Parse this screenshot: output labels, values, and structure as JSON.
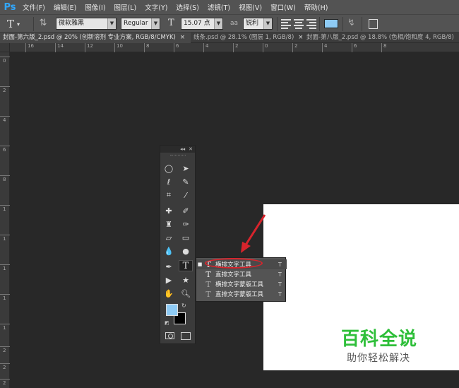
{
  "app": {
    "logo": "Ps"
  },
  "menu": [
    "文件(F)",
    "编辑(E)",
    "图像(I)",
    "图层(L)",
    "文字(Y)",
    "选择(S)",
    "滤镜(T)",
    "视图(V)",
    "窗口(W)",
    "帮助(H)"
  ],
  "options_bar": {
    "tool_glyph": "T",
    "font_family": "微软雅黑",
    "font_style": "Regular",
    "font_size": "15.07 点",
    "aa_label": "aa",
    "anti_alias": "锐利",
    "text_color": "#8ecbf5"
  },
  "tabs": [
    {
      "label": "封面-第六版_2.psd @ 20% (创新溶剂 专业方案, RGB/8/CMYK)",
      "close": "×"
    },
    {
      "label": "线条.psd @ 28.1% (图层 1, RGB/8)",
      "close": "×"
    },
    {
      "label": "封面-第八版_2.psd @ 18.8% (色相/饱和度 4, RGB/8)",
      "close": "×"
    }
  ],
  "ruler": {
    "horizontal": [
      "16",
      "14",
      "12",
      "10",
      "8",
      "6",
      "4",
      "2",
      "0",
      "2",
      "4",
      "6",
      "8"
    ],
    "vertical": [
      "0",
      "2",
      "4",
      "6",
      "8",
      "1",
      "1",
      "1",
      "1",
      "1",
      "2",
      "2",
      "2"
    ]
  },
  "toolbox": {
    "foreground_color": "#8ecbf5",
    "background_color": "#000000"
  },
  "flyout": {
    "items": [
      {
        "label": "横排文字工具",
        "key": "T",
        "active": true
      },
      {
        "label": "直排文字工具",
        "key": "T",
        "active": false
      },
      {
        "label": "横排文字蒙版工具",
        "key": "T",
        "active": false
      },
      {
        "label": "直排文字蒙版工具",
        "key": "T",
        "active": false
      }
    ]
  },
  "watermark": {
    "title": "百科全说",
    "subtitle": "助你轻松解决",
    "title_color": "#2fbf3a"
  }
}
